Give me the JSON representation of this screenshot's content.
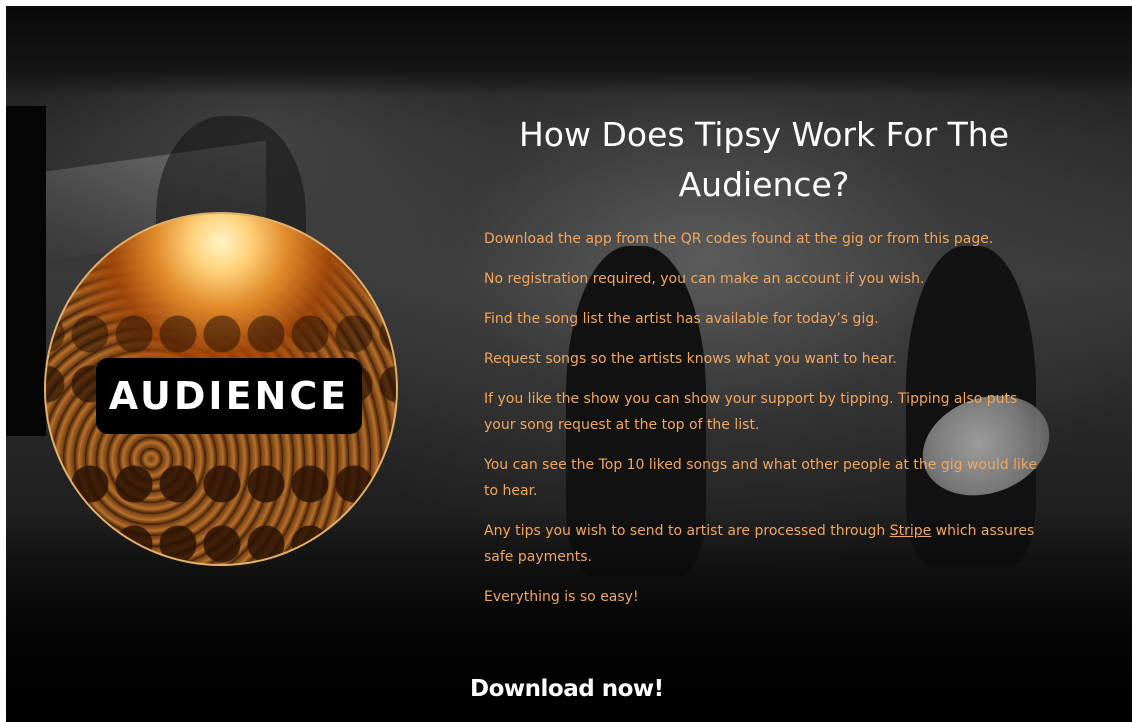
{
  "section": {
    "title": "How Does Tipsy Work For The Audience?",
    "badge_label": "AUDIENCE",
    "paragraphs": [
      "Download the app from the QR codes found at the gig or from this page.",
      "No registration required, you can make an account if you wish.",
      "Find the song list the artist has available for today’s gig.",
      "Request songs so the artists knows what you want to hear.",
      "If you like the show you can show your support by tipping. Tipping also puts your song request at the top of the list.",
      "You can see the Top 10 liked songs and what other people at the gig would like to hear."
    ],
    "stripe_paragraph": {
      "before": "Any tips you wish to send to artist are processed through ",
      "link": "Stripe",
      "after": " which assures safe payments."
    },
    "closing": "Everything is so easy!",
    "download_label": "Download now!"
  },
  "colors": {
    "background": "#0b0b0b",
    "title_text": "#ffffff",
    "body_text": "#f2a65e",
    "badge_border": "#e1b06b",
    "badge_label_bg": "#000000"
  }
}
